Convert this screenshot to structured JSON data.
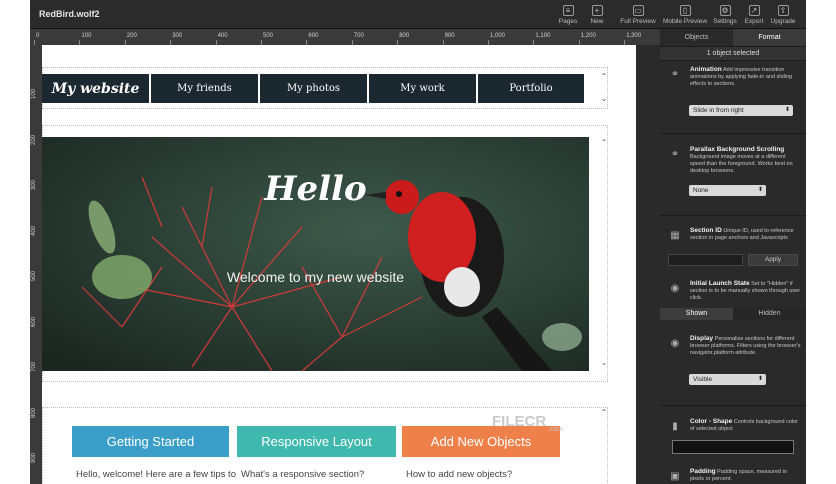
{
  "app": {
    "title": "RedBird.wolf2"
  },
  "toolbar": [
    {
      "label": "Pages",
      "icon": "pages-icon",
      "glyph": "≡"
    },
    {
      "label": "New",
      "icon": "plus-icon",
      "glyph": "+"
    },
    {
      "label": "Full Preview",
      "icon": "monitor-icon",
      "glyph": "▭"
    },
    {
      "label": "Mobile Preview",
      "icon": "mobile-icon",
      "glyph": "▯"
    },
    {
      "label": "Settings",
      "icon": "gear-icon",
      "glyph": "⚙"
    },
    {
      "label": "Export",
      "icon": "export-icon",
      "glyph": "↗"
    },
    {
      "label": "Upgrade",
      "icon": "upgrade-icon",
      "glyph": "⇧"
    }
  ],
  "ruler": {
    "top": [
      "0",
      "100",
      "200",
      "300",
      "400",
      "500",
      "600",
      "700",
      "800",
      "900",
      "1,000",
      "1,100",
      "1,200",
      "1,300"
    ],
    "left": [
      "100",
      "200",
      "300",
      "400",
      "500",
      "600",
      "700",
      "800",
      "900"
    ]
  },
  "nav": {
    "brand": "My website",
    "items": [
      "My friends",
      "My photos",
      "My work",
      "Portfolio"
    ]
  },
  "hero": {
    "title": "Hello",
    "subtitle": "Welcome to my new website"
  },
  "cta": {
    "getting_started": "Getting Started",
    "responsive_layout": "Responsive Layout",
    "add_new_objects": "Add New Objects"
  },
  "columns": {
    "col1": "Hello, welcome!  Here are a few tips to",
    "col2": "What's a responsive section?",
    "col3": "How to add new objects?"
  },
  "watermark": {
    "main": "FILECR",
    "sub": ".com"
  },
  "panel": {
    "tabs": {
      "objects": "Objects",
      "format": "Format"
    },
    "selected": "1 object selected",
    "animation": {
      "title": "Animation",
      "desc": "Add impressive transition animations by applying fade-in and sliding effects to sections.",
      "value": "Slide in from right"
    },
    "parallax": {
      "title": "Parallax Background Scrolling",
      "desc": "Background image moves at a different speed than the foreground. Works best on desktop browsers.",
      "value": "None"
    },
    "section_id": {
      "title": "Section ID",
      "desc": "Unique ID, used to reference section in page anchors and Javascripts",
      "apply": "Apply"
    },
    "launch_state": {
      "title": "Initial Launch State",
      "desc": "Set to \"Hidden\" if section is to be manually shown through user click.",
      "shown": "Shown",
      "hidden": "Hidden"
    },
    "display": {
      "title": "Display",
      "desc": "Personalize sections for different browser platforms. Filters using the browser's navigator.platform attribute.",
      "value": "Visible"
    },
    "color_shape": {
      "title": "Color - Shape",
      "desc": "Controls background color of selected object"
    },
    "padding": {
      "title": "Padding",
      "desc": "Padding space, measured in pixels or percent."
    }
  }
}
